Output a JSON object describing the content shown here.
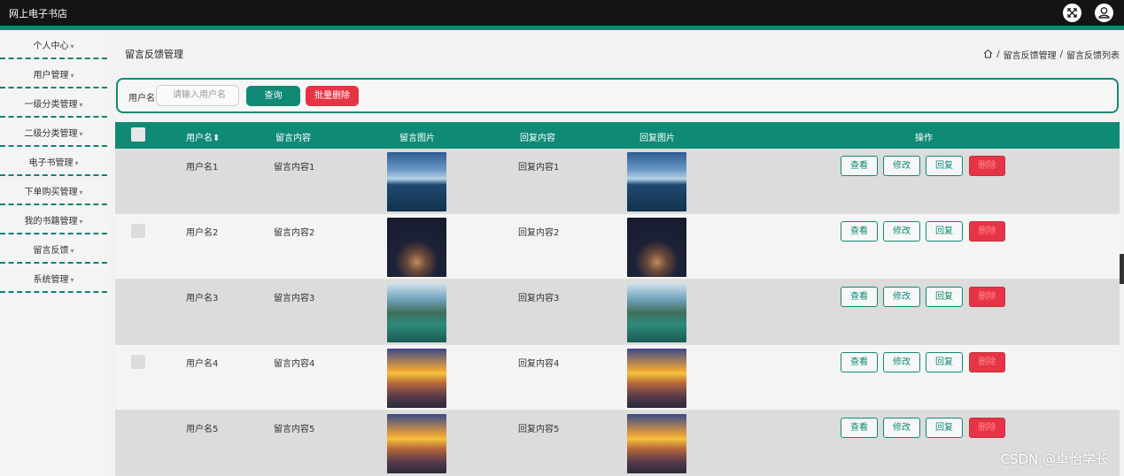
{
  "app": {
    "title": "网上电子书店"
  },
  "sidebar": {
    "items": [
      {
        "label": "个人中心"
      },
      {
        "label": "用户管理"
      },
      {
        "label": "一级分类管理"
      },
      {
        "label": "二级分类管理"
      },
      {
        "label": "电子书管理"
      },
      {
        "label": "下单购买管理"
      },
      {
        "label": "我的书籍管理"
      },
      {
        "label": "留言反馈"
      },
      {
        "label": "系统管理"
      }
    ],
    "caret": "▾"
  },
  "page": {
    "title": "留言反馈管理",
    "breadcrumb": {
      "sep": "/",
      "level1": "留言反馈管理",
      "level2": "留言反馈列表"
    }
  },
  "search": {
    "label": "用户名",
    "placeholder": "请输入用户名",
    "query_button": "查询",
    "batch_delete_button": "批量删除"
  },
  "table": {
    "headers": {
      "username": "用户名",
      "sort_glyph": "⬍",
      "message": "留言内容",
      "message_image": "留言图片",
      "reply": "回复内容",
      "reply_image": "回复图片",
      "actions": "操作"
    },
    "rows": [
      {
        "username": "用户名1",
        "message": "留言内容1",
        "reply": "回复内容1"
      },
      {
        "username": "用户名2",
        "message": "留言内容2",
        "reply": "回复内容2"
      },
      {
        "username": "用户名3",
        "message": "留言内容3",
        "reply": "回复内容3"
      },
      {
        "username": "用户名4",
        "message": "留言内容4",
        "reply": "回复内容4"
      },
      {
        "username": "用户名5",
        "message": "留言内容5",
        "reply": "回复内容5"
      }
    ],
    "action_labels": {
      "view": "查看",
      "edit": "修改",
      "reply": "回复",
      "delete": "删除"
    }
  },
  "watermark": "CSDN @卓怡学长",
  "colors": {
    "accent": "#0f8a75",
    "danger": "#e63446",
    "topbar": "#141414"
  }
}
